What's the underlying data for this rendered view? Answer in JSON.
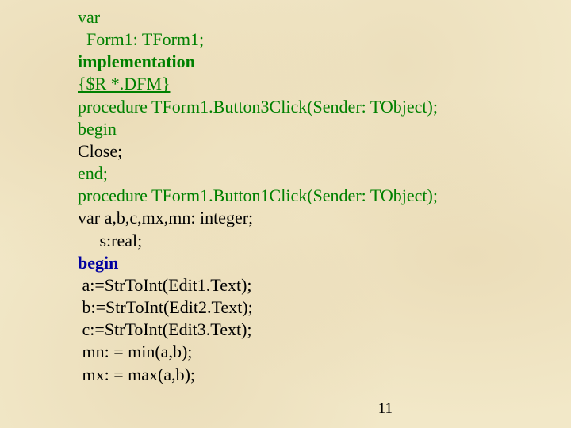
{
  "code": {
    "l1": "var",
    "l2": "  Form1: TForm1;",
    "l3": "implementation",
    "l4": "{$R *.DFM}",
    "l5": "procedure TForm1.Button3Click(Sender: TObject);",
    "l6": "begin",
    "l7": "Close;",
    "l8": "end;",
    "l9": "procedure TForm1.Button1Click(Sender: TObject);",
    "l10": "var a,b,c,mx,mn: integer;",
    "l11": "     s:real;",
    "l12": "begin",
    "l13": " a:=StrToInt(Edit1.Text);",
    "l14": " b:=StrToInt(Edit2.Text);",
    "l15": " c:=StrToInt(Edit3.Text);",
    "l16": " mn: = min(a,b);",
    "l17": " mx: = max(a,b);"
  },
  "page_number": "11"
}
